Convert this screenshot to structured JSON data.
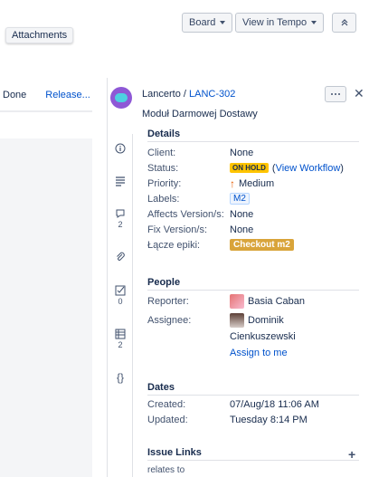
{
  "header": {
    "board_label": "Board",
    "tempo_label": "View in Tempo",
    "tooltip": "Attachments"
  },
  "left": {
    "status": "Done",
    "release": "Release..."
  },
  "issue": {
    "project": "Lancerto",
    "separator": "/",
    "key": "LANC-302",
    "summary": "Moduł Darmowej Dostawy"
  },
  "details": {
    "title": "Details",
    "client_label": "Client:",
    "client": "None",
    "status_label": "Status:",
    "status": "ON HOLD",
    "workflow_open": "(",
    "workflow": "View Workflow",
    "workflow_close": ")",
    "priority_label": "Priority:",
    "priority": "Medium",
    "labels_label": "Labels:",
    "labels": "M2",
    "affects_label": "Affects Version/s:",
    "affects": "None",
    "fix_label": "Fix Version/s:",
    "fix": "None",
    "epic_label": "Łącze epiki:",
    "epic": "Checkout m2"
  },
  "people": {
    "title": "People",
    "reporter_label": "Reporter:",
    "reporter": "Basia Caban",
    "assignee_label": "Assignee:",
    "assignee_first": "Dominik",
    "assignee_last": "Cienkuszewski",
    "assign_to_me": "Assign to me"
  },
  "dates": {
    "title": "Dates",
    "created_label": "Created:",
    "created": "07/Aug/18 11:06 AM",
    "updated_label": "Updated:",
    "updated": "Tuesday 8:14 PM"
  },
  "links": {
    "title": "Issue Links",
    "partial": "relates to"
  },
  "rail": {
    "comments_count": "2",
    "checks_count": "0",
    "table_count": "2"
  }
}
